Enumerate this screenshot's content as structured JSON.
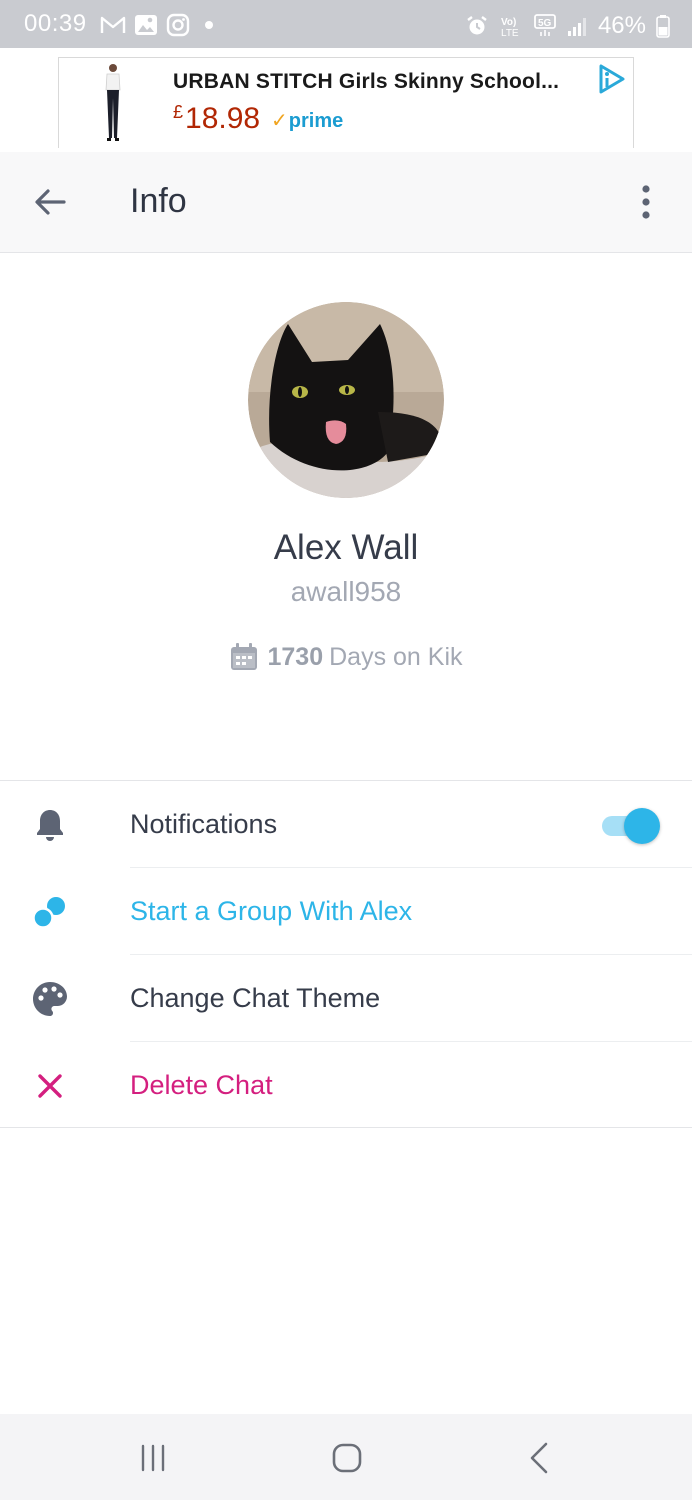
{
  "status_bar": {
    "time": "00:39",
    "battery": "46%",
    "icons": [
      "gmail-icon",
      "gallery-icon",
      "instagram-icon",
      "dot-icon",
      "alarm-icon",
      "volte-icon",
      "5g-icon",
      "signal-icon",
      "battery-icon"
    ]
  },
  "ad": {
    "title": "URBAN STITCH Girls Skinny School...",
    "currency": "£",
    "price": "18.98",
    "prime_label": "prime"
  },
  "toolbar": {
    "title": "Info"
  },
  "profile": {
    "name": "Alex Wall",
    "username": "awall958",
    "days_count": "1730",
    "days_label": "Days on Kik"
  },
  "options": [
    {
      "label": "Notifications",
      "icon": "bell-icon",
      "toggle_on": true
    },
    {
      "label": "Start a Group With Alex",
      "icon": "group-icon"
    },
    {
      "label": "Change Chat Theme",
      "icon": "palette-icon"
    },
    {
      "label": "Delete Chat",
      "icon": "close-icon"
    }
  ],
  "colors": {
    "accent_blue": "#2db5e8",
    "delete_pink": "#d41f7f",
    "text_dark": "#363c4a",
    "text_muted": "#a3a8b3"
  }
}
